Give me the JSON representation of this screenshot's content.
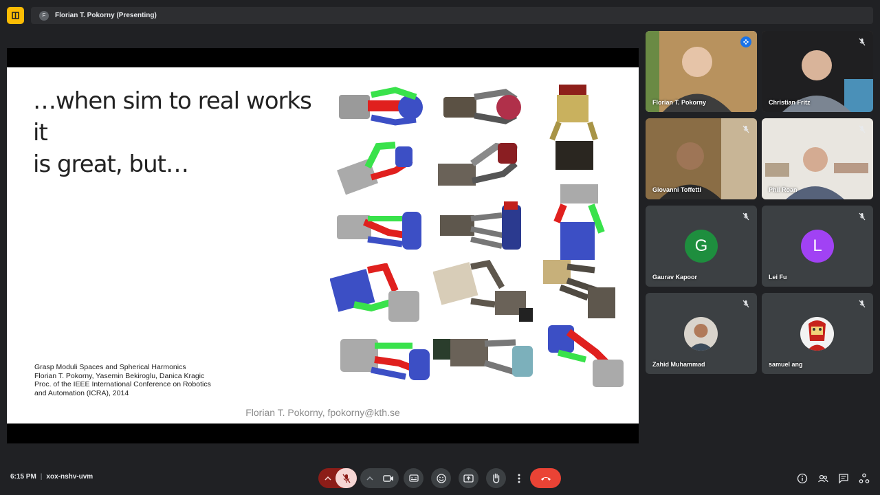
{
  "header": {
    "presenter_initial": "F",
    "presenter_label": "Florian T. Pokorny (Presenting)"
  },
  "slide": {
    "title_line1": "…when sim to real works it",
    "title_line2": "is great, but…",
    "citation": [
      "Grasp Moduli Spaces and Spherical Harmonics",
      "Florian T. Pokorny, Yasemin Bekiroglu, Danica Kragic",
      "Proc. of the IEEE International Conference on Robotics",
      "and Automation (ICRA), 2014"
    ],
    "footer": "Florian T. Pokorny, fpokorny@kth.se"
  },
  "participants": [
    {
      "name": "Florian T. Pokorny",
      "type": "video",
      "speaking": true
    },
    {
      "name": "Christian Fritz",
      "type": "video",
      "muted": true
    },
    {
      "name": "Giovanni Toffetti",
      "type": "video",
      "muted": true
    },
    {
      "name": "Phil Roan",
      "type": "video",
      "muted": true
    },
    {
      "name": "Gaurav Kapoor",
      "type": "avatar",
      "initial": "G",
      "color": "#1e8e3e",
      "muted": true
    },
    {
      "name": "Lei Fu",
      "type": "avatar",
      "initial": "L",
      "color": "#a142f4",
      "muted": true
    },
    {
      "name": "Zahid Muhammad",
      "type": "photo",
      "muted": true
    },
    {
      "name": "samuel ang",
      "type": "photo",
      "muted": true
    }
  ],
  "footer": {
    "time": "6:15 PM",
    "meeting_code": "xox-nshv-uvm"
  },
  "colors": {
    "leave": "#ea4335",
    "mic_off_bg": "#f6d6d4",
    "accent": "#8ab4f8"
  },
  "icons": [
    "chevron-up-icon",
    "mic-off-icon",
    "camera-icon",
    "captions-icon",
    "emoji-icon",
    "present-icon",
    "raise-hand-icon",
    "more-options-icon",
    "end-call-icon",
    "info-icon",
    "people-icon",
    "chat-icon",
    "activities-icon"
  ]
}
